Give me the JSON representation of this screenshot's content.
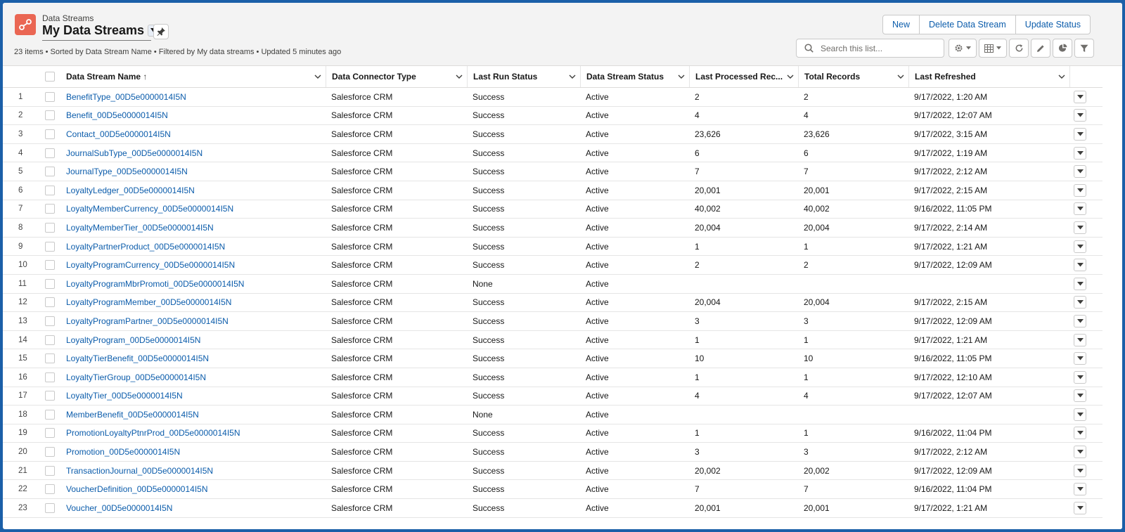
{
  "header": {
    "object_label": "Data Streams",
    "list_title": "My Data Streams",
    "meta": "23 items • Sorted by Data Stream Name • Filtered by My data streams • Updated 5 minutes ago",
    "buttons": {
      "new": "New",
      "delete": "Delete Data Stream",
      "update": "Update Status"
    },
    "search_placeholder": "Search this list..."
  },
  "columns": [
    "Data Stream Name",
    "Data Connector Type",
    "Last Run Status",
    "Data Stream Status",
    "Last Processed Rec...",
    "Total Records",
    "Last Refreshed"
  ],
  "sort_indicator": "↑",
  "rows": [
    {
      "n": "1",
      "name": "BenefitType_00D5e0000014I5N",
      "connector": "Salesforce CRM",
      "run": "Success",
      "status": "Active",
      "processed": "2",
      "total": "2",
      "refreshed": "9/17/2022, 1:20 AM"
    },
    {
      "n": "2",
      "name": "Benefit_00D5e0000014I5N",
      "connector": "Salesforce CRM",
      "run": "Success",
      "status": "Active",
      "processed": "4",
      "total": "4",
      "refreshed": "9/17/2022, 12:07 AM"
    },
    {
      "n": "3",
      "name": "Contact_00D5e0000014I5N",
      "connector": "Salesforce CRM",
      "run": "Success",
      "status": "Active",
      "processed": "23,626",
      "total": "23,626",
      "refreshed": "9/17/2022, 3:15 AM"
    },
    {
      "n": "4",
      "name": "JournalSubType_00D5e0000014I5N",
      "connector": "Salesforce CRM",
      "run": "Success",
      "status": "Active",
      "processed": "6",
      "total": "6",
      "refreshed": "9/17/2022, 1:19 AM"
    },
    {
      "n": "5",
      "name": "JournalType_00D5e0000014I5N",
      "connector": "Salesforce CRM",
      "run": "Success",
      "status": "Active",
      "processed": "7",
      "total": "7",
      "refreshed": "9/17/2022, 2:12 AM"
    },
    {
      "n": "6",
      "name": "LoyaltyLedger_00D5e0000014I5N",
      "connector": "Salesforce CRM",
      "run": "Success",
      "status": "Active",
      "processed": "20,001",
      "total": "20,001",
      "refreshed": "9/17/2022, 2:15 AM"
    },
    {
      "n": "7",
      "name": "LoyaltyMemberCurrency_00D5e0000014I5N",
      "connector": "Salesforce CRM",
      "run": "Success",
      "status": "Active",
      "processed": "40,002",
      "total": "40,002",
      "refreshed": "9/16/2022, 11:05 PM"
    },
    {
      "n": "8",
      "name": "LoyaltyMemberTier_00D5e0000014I5N",
      "connector": "Salesforce CRM",
      "run": "Success",
      "status": "Active",
      "processed": "20,004",
      "total": "20,004",
      "refreshed": "9/17/2022, 2:14 AM"
    },
    {
      "n": "9",
      "name": "LoyaltyPartnerProduct_00D5e0000014I5N",
      "connector": "Salesforce CRM",
      "run": "Success",
      "status": "Active",
      "processed": "1",
      "total": "1",
      "refreshed": "9/17/2022, 1:21 AM"
    },
    {
      "n": "10",
      "name": "LoyaltyProgramCurrency_00D5e0000014I5N",
      "connector": "Salesforce CRM",
      "run": "Success",
      "status": "Active",
      "processed": "2",
      "total": "2",
      "refreshed": "9/17/2022, 12:09 AM"
    },
    {
      "n": "11",
      "name": "LoyaltyProgramMbrPromoti_00D5e0000014I5N",
      "connector": "Salesforce CRM",
      "run": "None",
      "status": "Active",
      "processed": "",
      "total": "",
      "refreshed": ""
    },
    {
      "n": "12",
      "name": "LoyaltyProgramMember_00D5e0000014I5N",
      "connector": "Salesforce CRM",
      "run": "Success",
      "status": "Active",
      "processed": "20,004",
      "total": "20,004",
      "refreshed": "9/17/2022, 2:15 AM"
    },
    {
      "n": "13",
      "name": "LoyaltyProgramPartner_00D5e0000014I5N",
      "connector": "Salesforce CRM",
      "run": "Success",
      "status": "Active",
      "processed": "3",
      "total": "3",
      "refreshed": "9/17/2022, 12:09 AM"
    },
    {
      "n": "14",
      "name": "LoyaltyProgram_00D5e0000014I5N",
      "connector": "Salesforce CRM",
      "run": "Success",
      "status": "Active",
      "processed": "1",
      "total": "1",
      "refreshed": "9/17/2022, 1:21 AM"
    },
    {
      "n": "15",
      "name": "LoyaltyTierBenefit_00D5e0000014I5N",
      "connector": "Salesforce CRM",
      "run": "Success",
      "status": "Active",
      "processed": "10",
      "total": "10",
      "refreshed": "9/16/2022, 11:05 PM"
    },
    {
      "n": "16",
      "name": "LoyaltyTierGroup_00D5e0000014I5N",
      "connector": "Salesforce CRM",
      "run": "Success",
      "status": "Active",
      "processed": "1",
      "total": "1",
      "refreshed": "9/17/2022, 12:10 AM"
    },
    {
      "n": "17",
      "name": "LoyaltyTier_00D5e0000014I5N",
      "connector": "Salesforce CRM",
      "run": "Success",
      "status": "Active",
      "processed": "4",
      "total": "4",
      "refreshed": "9/17/2022, 12:07 AM"
    },
    {
      "n": "18",
      "name": "MemberBenefit_00D5e0000014I5N",
      "connector": "Salesforce CRM",
      "run": "None",
      "status": "Active",
      "processed": "",
      "total": "",
      "refreshed": ""
    },
    {
      "n": "19",
      "name": "PromotionLoyaltyPtnrProd_00D5e0000014I5N",
      "connector": "Salesforce CRM",
      "run": "Success",
      "status": "Active",
      "processed": "1",
      "total": "1",
      "refreshed": "9/16/2022, 11:04 PM"
    },
    {
      "n": "20",
      "name": "Promotion_00D5e0000014I5N",
      "connector": "Salesforce CRM",
      "run": "Success",
      "status": "Active",
      "processed": "3",
      "total": "3",
      "refreshed": "9/17/2022, 2:12 AM"
    },
    {
      "n": "21",
      "name": "TransactionJournal_00D5e0000014I5N",
      "connector": "Salesforce CRM",
      "run": "Success",
      "status": "Active",
      "processed": "20,002",
      "total": "20,002",
      "refreshed": "9/17/2022, 12:09 AM"
    },
    {
      "n": "22",
      "name": "VoucherDefinition_00D5e0000014I5N",
      "connector": "Salesforce CRM",
      "run": "Success",
      "status": "Active",
      "processed": "7",
      "total": "7",
      "refreshed": "9/16/2022, 11:04 PM"
    },
    {
      "n": "23",
      "name": "Voucher_00D5e0000014I5N",
      "connector": "Salesforce CRM",
      "run": "Success",
      "status": "Active",
      "processed": "20,001",
      "total": "20,001",
      "refreshed": "9/17/2022, 1:21 AM"
    }
  ],
  "icons": {
    "app": "data-stream-icon",
    "caret": "chevron-down-icon",
    "pin": "pin-icon",
    "search": "search-icon",
    "settings": "gear-icon",
    "display": "table-view-icon",
    "refresh": "refresh-icon",
    "edit": "pencil-icon",
    "charts": "pie-chart-icon",
    "filter": "filter-icon"
  },
  "colors": {
    "brand": "#1b5fa8",
    "link": "#0b5cab",
    "app_icon": "#ea6653"
  }
}
